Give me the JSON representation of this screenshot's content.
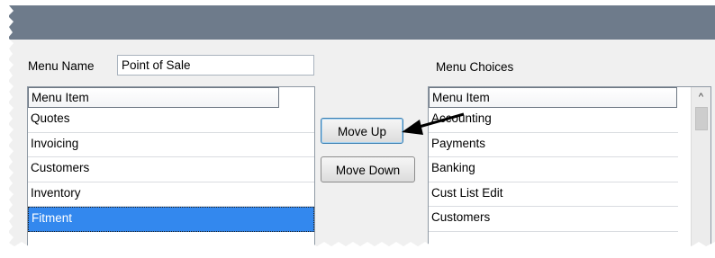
{
  "form": {
    "menu_name_label": "Menu Name",
    "menu_name_value": "Point of Sale",
    "menu_choices_label": "Menu Choices"
  },
  "menu_items_list": {
    "header": "Menu Item",
    "items": [
      "Quotes",
      "Invoicing",
      "Customers",
      "Inventory",
      "Fitment"
    ],
    "selected_item": "Fitment"
  },
  "buttons": {
    "move_up": "Move Up",
    "move_down": "Move Down"
  },
  "menu_choices_list": {
    "header": "Menu Item",
    "items": [
      "Accounting",
      "Payments",
      "Banking",
      "Cust List Edit",
      "Customers"
    ]
  },
  "scrollbar": {
    "up_arrow_glyph": "^"
  },
  "colors": {
    "selection": "#3388ee",
    "titlebar": "#6e7b8b",
    "annotation_arrow": "#000000"
  },
  "icons": [
    "up-arrow-icon",
    "annotation-arrow-icon"
  ]
}
